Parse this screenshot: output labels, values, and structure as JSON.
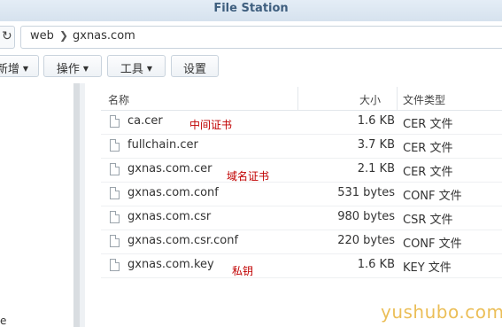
{
  "window": {
    "title": "File Station"
  },
  "path": {
    "crumbs": [
      "web",
      "gxnas.com"
    ]
  },
  "toolbar": {
    "buttons": [
      {
        "label": "新增",
        "caret": "▼"
      },
      {
        "label": "操作",
        "caret": "▼"
      },
      {
        "label": "工具",
        "caret": "▼"
      },
      {
        "label": "设置",
        "caret": ""
      }
    ]
  },
  "left_pane": {
    "tail_text": "e"
  },
  "file_list": {
    "columns": {
      "name": "名称",
      "size": "大小",
      "type": "文件类型"
    },
    "files": [
      {
        "name": "ca.cer",
        "size": "1.6 KB",
        "type": "CER 文件"
      },
      {
        "name": "fullchain.cer",
        "size": "3.7 KB",
        "type": "CER 文件"
      },
      {
        "name": "gxnas.com.cer",
        "size": "2.1 KB",
        "type": "CER 文件"
      },
      {
        "name": "gxnas.com.conf",
        "size": "531 bytes",
        "type": "CONF 文件"
      },
      {
        "name": "gxnas.com.csr",
        "size": "980 bytes",
        "type": "CSR 文件"
      },
      {
        "name": "gxnas.com.csr.conf",
        "size": "220 bytes",
        "type": "CONF 文件"
      },
      {
        "name": "gxnas.com.key",
        "size": "1.6 KB",
        "type": "KEY 文件"
      }
    ]
  },
  "annotations": {
    "ca": "中间证书",
    "domain": "域名证书",
    "key": "私钥"
  },
  "watermark": "yushubo.com",
  "colors": {
    "annotation": "#c00000",
    "watermark": "#e8b33a",
    "title": "#3f5f7f"
  }
}
